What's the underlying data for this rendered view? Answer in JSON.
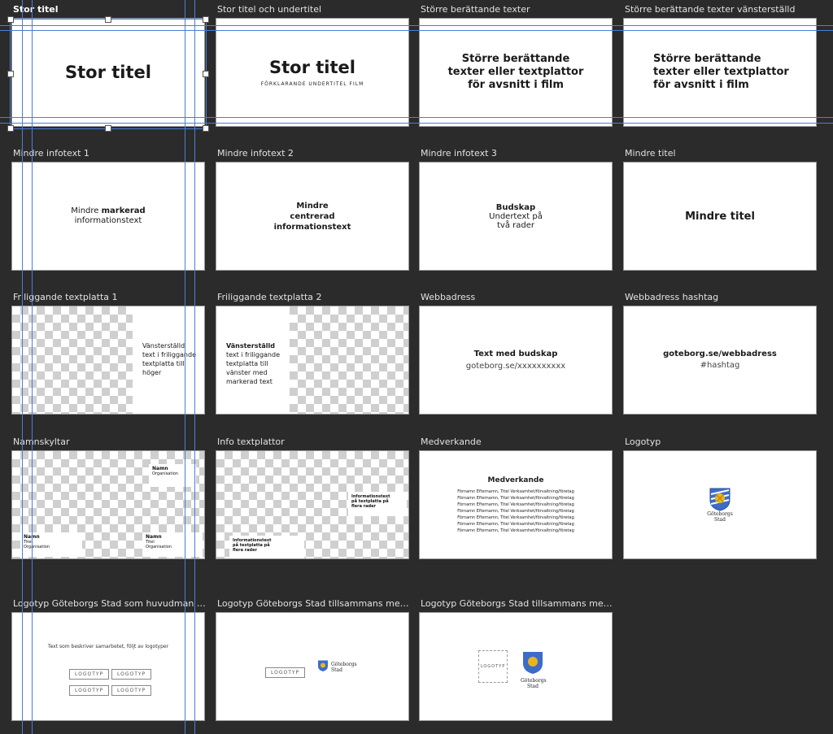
{
  "thumbs": [
    {
      "label": "Stor titel",
      "title": "Stor titel"
    },
    {
      "label": "Stor titel och undertitel",
      "title": "Stor titel",
      "subtitle": "FÖRKLARANDE UNDERTITEL FILM"
    },
    {
      "label": "Större berättande texter",
      "lines": [
        "Större berättande",
        "texter eller textplattor",
        "för avsnitt i film"
      ]
    },
    {
      "label": "Större berättande texter vänsterställd",
      "lines": [
        "Större berättande",
        "texter eller textplattor",
        "för avsnitt i film"
      ]
    },
    {
      "label": "Mindre infotext 1",
      "line1_prefix": "Mindre ",
      "line1_bold": "markerad",
      "line2": "informationstext"
    },
    {
      "label": "Mindre infotext 2",
      "lines": [
        "Mindre",
        "centrerad",
        "informationstext"
      ]
    },
    {
      "label": "Mindre infotext 3",
      "heading": "Budskap",
      "lines": [
        "Undertext på",
        "två rader"
      ]
    },
    {
      "label": "Mindre titel",
      "title": "Mindre titel"
    },
    {
      "label": "Friliggande textplatta 1",
      "lines": [
        "Vänsterställd",
        "text i friliggande",
        "textplatta till",
        "höger"
      ]
    },
    {
      "label": "Friliggande textplatta 2",
      "heading": "Vänsterställd",
      "lines": [
        "text i friliggande",
        "textplatta till",
        "vänster med",
        "markerad text"
      ]
    },
    {
      "label": "Webbadress",
      "heading": "Text med budskap",
      "url": "goteborg.se/xxxxxxxxxx"
    },
    {
      "label": "Webbadress hashtag",
      "heading": "goteborg.se/webbadress",
      "hashtag": "#hashtag"
    },
    {
      "label": "Namnskyltar",
      "name": "Namn",
      "title": "Titel",
      "org": "Organisation"
    },
    {
      "label": "Info textplattor",
      "lines": [
        "Informationstext",
        "på textplatta på",
        "flera rader"
      ]
    },
    {
      "label": "Medverkande",
      "heading": "Medverkande",
      "credit": "Förnamn Efternamn, Titel Verksamhet/förvaltning/företag"
    },
    {
      "label": "Logotyp",
      "logo_text": [
        "Göteborgs",
        "Stad"
      ]
    },
    {
      "label": "Logotyp Göteborgs Stad som huvudman tillsammans med flera",
      "caption": "Text som beskriver samarbetet, följt av logotyper",
      "logo_label": "LOGOTYP"
    },
    {
      "label": "Logotyp Göteborgs Stad tillsammans med likvärdig part",
      "logo_label": "LOGOTYP",
      "logo_text": [
        "Göteborgs",
        "Stad"
      ]
    },
    {
      "label": "Logotyp Göteborgs Stad tillsammans med likvärdig part stående",
      "logo_label": "LOGOTYP",
      "logo_text": [
        "Göteborgs",
        "Stad"
      ]
    }
  ],
  "colors": {
    "background": "#2b2b2b",
    "guide": "#4a7ed8",
    "crest_blue": "#3c6cc8",
    "crest_gold": "#e8b520"
  }
}
